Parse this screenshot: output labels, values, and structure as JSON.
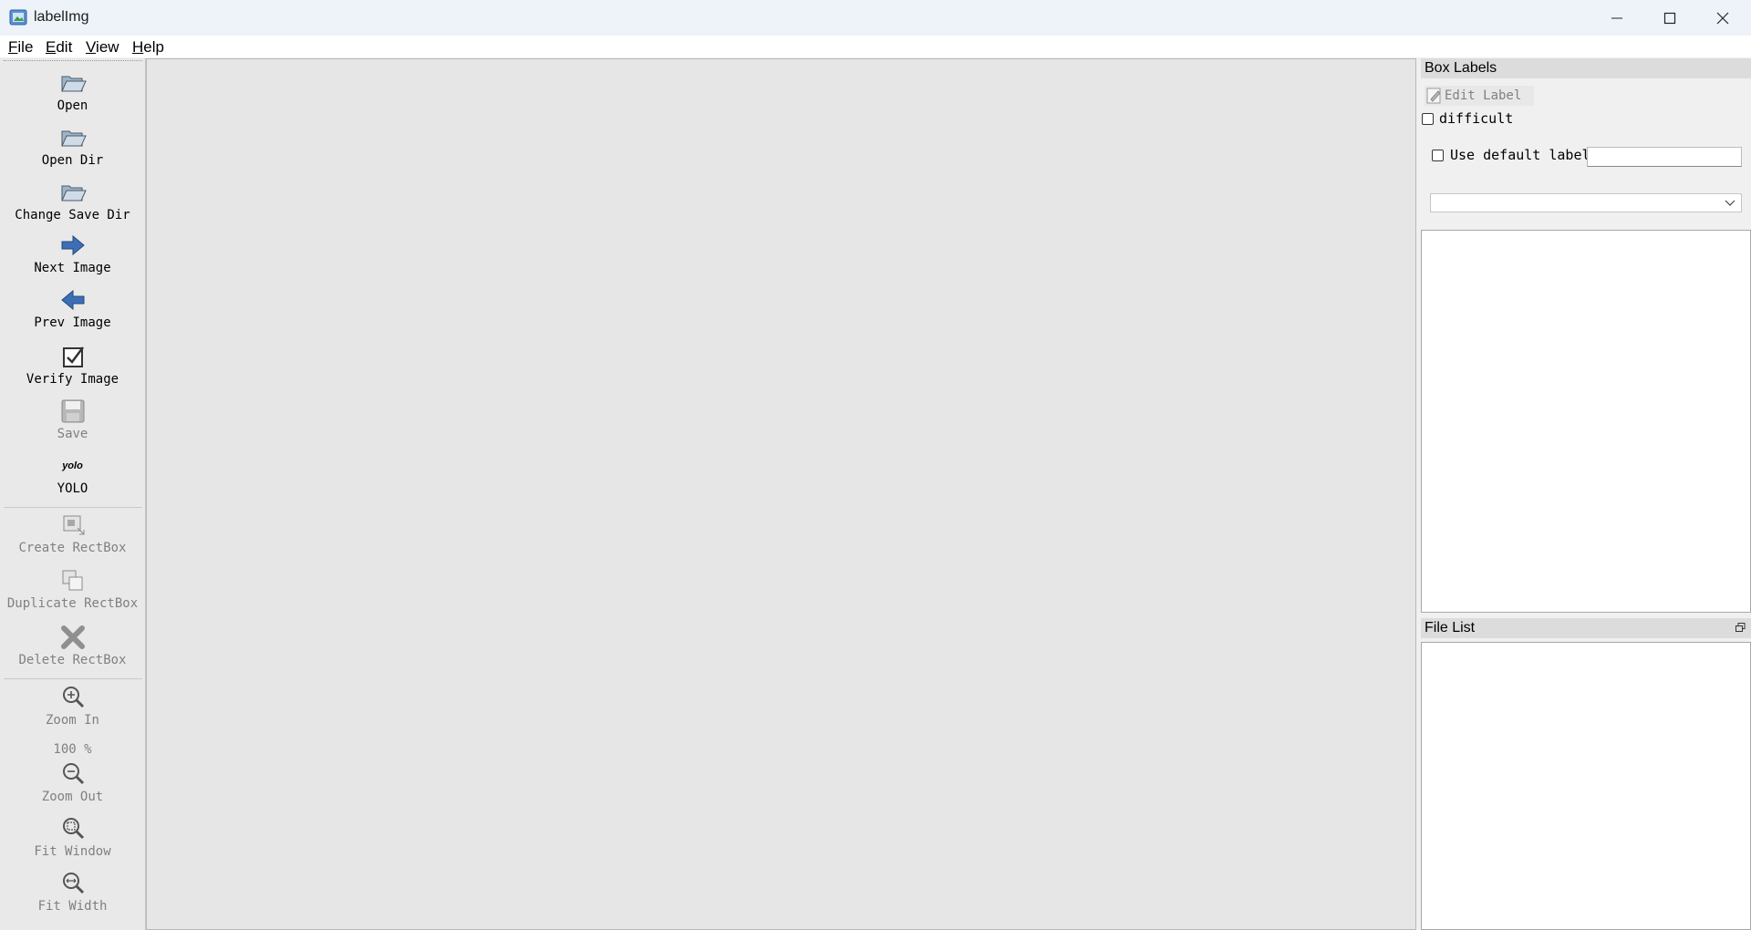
{
  "window": {
    "title": "labelImg"
  },
  "menu": {
    "file": "File",
    "edit": "Edit",
    "view": "View",
    "help": "Help"
  },
  "toolbar": {
    "open": "Open",
    "open_dir": "Open Dir",
    "change_save_dir": "Change Save Dir",
    "next_image": "Next Image",
    "prev_image": "Prev Image",
    "verify_image": "Verify Image",
    "save": "Save",
    "format_icon_text": "yolo",
    "format_label": "YOLO",
    "create_rectbox": "Create RectBox",
    "duplicate_rectbox": "Duplicate RectBox",
    "delete_rectbox": "Delete RectBox",
    "zoom_in": "Zoom In",
    "zoom_value": "100 %",
    "zoom_out": "Zoom Out",
    "fit_window": "Fit Window",
    "fit_width": "Fit Width"
  },
  "box_labels": {
    "title": "Box Labels",
    "edit_label": "Edit Label",
    "difficult": "difficult",
    "use_default_label": "Use default label",
    "default_label_value": "",
    "combo_value": ""
  },
  "file_list": {
    "title": "File List"
  },
  "colors": {
    "titlebar": "#eef3f9",
    "canvas": "#e6e6e6",
    "arrow_blue": "#3d6fb6"
  }
}
